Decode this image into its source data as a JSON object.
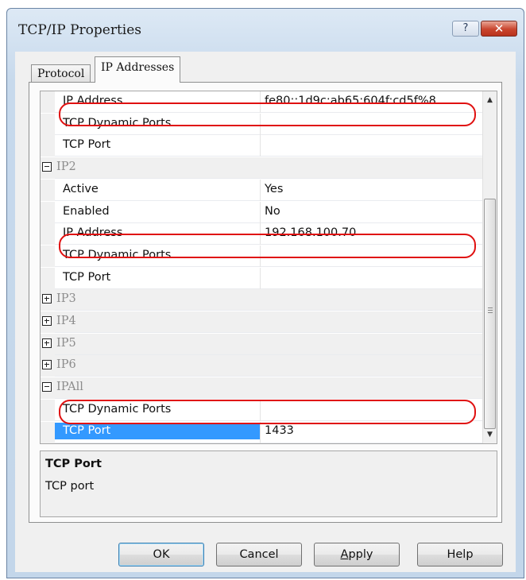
{
  "window": {
    "title": "TCP/IP Properties",
    "help_label": "?",
    "close_label": "✕"
  },
  "tabs": [
    {
      "label": "Protocol",
      "selected": false
    },
    {
      "label": "IP Addresses",
      "selected": true
    }
  ],
  "grid": {
    "rows": [
      {
        "kind": "prop",
        "name": "IP Address",
        "value": "fe80::1d9c:ab65:604f:cd5f%8"
      },
      {
        "kind": "prop",
        "name": "TCP Dynamic Ports",
        "value": ""
      },
      {
        "kind": "prop",
        "name": "TCP Port",
        "value": ""
      },
      {
        "kind": "cat",
        "name": "IP2",
        "expanded": true
      },
      {
        "kind": "prop",
        "name": "Active",
        "value": "Yes"
      },
      {
        "kind": "prop",
        "name": "Enabled",
        "value": "No"
      },
      {
        "kind": "prop",
        "name": "IP Address",
        "value": "192.168.100.70"
      },
      {
        "kind": "prop",
        "name": "TCP Dynamic Ports",
        "value": ""
      },
      {
        "kind": "prop",
        "name": "TCP Port",
        "value": ""
      },
      {
        "kind": "cat",
        "name": "IP3",
        "expanded": false
      },
      {
        "kind": "cat",
        "name": "IP4",
        "expanded": false
      },
      {
        "kind": "cat",
        "name": "IP5",
        "expanded": false
      },
      {
        "kind": "cat",
        "name": "IP6",
        "expanded": false
      },
      {
        "kind": "cat",
        "name": "IPAll",
        "expanded": true
      },
      {
        "kind": "prop",
        "name": "TCP Dynamic Ports",
        "value": ""
      },
      {
        "kind": "prop",
        "name": "TCP Port",
        "value": "1433",
        "selected": true
      }
    ]
  },
  "description": {
    "title": "TCP Port",
    "text": "TCP port"
  },
  "buttons": {
    "ok": "OK",
    "cancel": "Cancel",
    "apply_underlined": "A",
    "apply_rest": "pply",
    "help": "Help"
  },
  "colors": {
    "selection": "#3399ff",
    "annotation_red": "#e01010",
    "annotation_blue": "#1836e8"
  }
}
